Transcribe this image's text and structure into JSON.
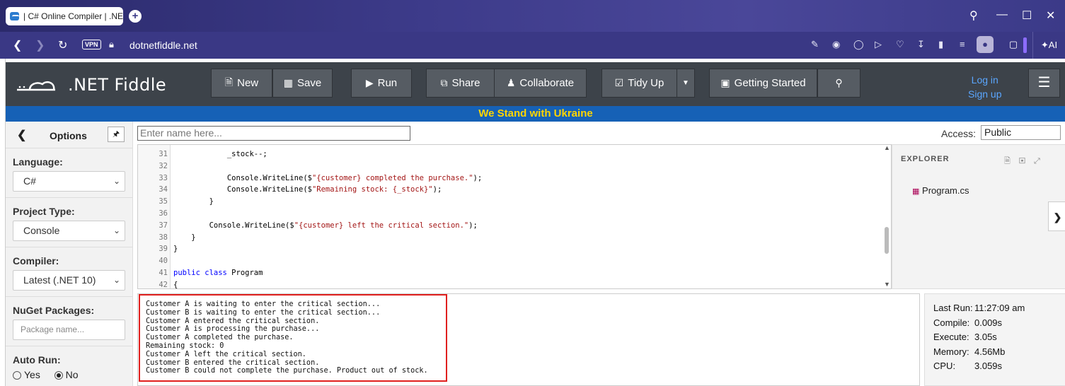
{
  "browser": {
    "tab_title": "| C# Online Compiler | .NE",
    "url": "dotnetfiddle.net",
    "vpn_label": "VPN",
    "ai_label": "AI"
  },
  "header": {
    "logo_text": ".NET Fiddle",
    "buttons": {
      "new": "New",
      "save": "Save",
      "run": "Run",
      "share": "Share",
      "collaborate": "Collaborate",
      "tidy": "Tidy Up",
      "getting_started": "Getting Started"
    },
    "login": "Log in",
    "signup": "Sign up"
  },
  "banner": "We Stand with Ukraine",
  "sidebar": {
    "title": "Options",
    "language_label": "Language:",
    "language_value": "C#",
    "project_label": "Project Type:",
    "project_value": "Console",
    "compiler_label": "Compiler:",
    "compiler_value": "Latest (.NET 10)",
    "nuget_label": "NuGet Packages:",
    "nuget_placeholder": "Package name...",
    "autorun_label": "Auto Run:",
    "autorun_yes": "Yes",
    "autorun_no": "No"
  },
  "editor": {
    "name_placeholder": "Enter name here...",
    "access_label": "Access:",
    "access_value": "Public",
    "lines": [
      {
        "n": "31",
        "parts": [
          {
            "t": "            _stock--;",
            "c": ""
          }
        ]
      },
      {
        "n": "32",
        "parts": [
          {
            "t": "",
            "c": ""
          }
        ]
      },
      {
        "n": "33",
        "parts": [
          {
            "t": "            Console.WriteLine($",
            "c": ""
          },
          {
            "t": "\"{customer} completed the purchase.\"",
            "c": "str"
          },
          {
            "t": ");",
            "c": ""
          }
        ]
      },
      {
        "n": "34",
        "parts": [
          {
            "t": "            Console.WriteLine($",
            "c": ""
          },
          {
            "t": "\"Remaining stock: {_stock}\"",
            "c": "str"
          },
          {
            "t": ");",
            "c": ""
          }
        ]
      },
      {
        "n": "35",
        "parts": [
          {
            "t": "        }",
            "c": ""
          }
        ]
      },
      {
        "n": "36",
        "parts": [
          {
            "t": "",
            "c": ""
          }
        ]
      },
      {
        "n": "37",
        "parts": [
          {
            "t": "        Console.WriteLine($",
            "c": ""
          },
          {
            "t": "\"{customer} left the critical section.\"",
            "c": "str"
          },
          {
            "t": ");",
            "c": ""
          }
        ]
      },
      {
        "n": "38",
        "parts": [
          {
            "t": "    }",
            "c": ""
          }
        ]
      },
      {
        "n": "39",
        "parts": [
          {
            "t": "}",
            "c": ""
          }
        ]
      },
      {
        "n": "40",
        "parts": [
          {
            "t": "",
            "c": ""
          }
        ]
      },
      {
        "n": "41",
        "parts": [
          {
            "t": "public class",
            "c": "kw"
          },
          {
            "t": " Program",
            "c": ""
          }
        ]
      },
      {
        "n": "42",
        "parts": [
          {
            "t": "{",
            "c": ""
          }
        ]
      }
    ]
  },
  "explorer": {
    "title": "EXPLORER",
    "file": "Program.cs"
  },
  "output": {
    "lines": [
      "Customer A is waiting to enter the critical section...",
      "Customer B is waiting to enter the critical section...",
      "Customer A entered the critical section.",
      "Customer A is processing the purchase...",
      "Customer A completed the purchase.",
      "Remaining stock: 0",
      "Customer A left the critical section.",
      "Customer B entered the critical section.",
      "Customer B could not complete the purchase. Product out of stock."
    ]
  },
  "stats": [
    {
      "k": "Last Run:",
      "v": "11:27:09 am"
    },
    {
      "k": "Compile:",
      "v": "0.009s"
    },
    {
      "k": "Execute:",
      "v": "3.05s"
    },
    {
      "k": "Memory:",
      "v": "4.56Mb"
    },
    {
      "k": "CPU:",
      "v": "3.059s"
    }
  ]
}
